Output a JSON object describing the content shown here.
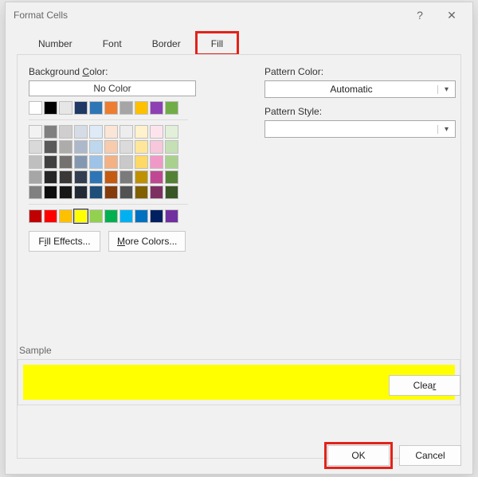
{
  "window": {
    "title": "Format Cells",
    "help": "?",
    "close": "✕"
  },
  "tabs": {
    "items": [
      "Number",
      "Font",
      "Border",
      "Fill"
    ],
    "active_index": 3,
    "highlight_index": 3
  },
  "fill": {
    "bg_label": "Background Color:",
    "nocolor_label": "No Color",
    "fill_effects": "Fill Effects...",
    "more_colors": "More Colors...",
    "theme_row0": [
      "#ffffff",
      "#000000",
      "#e7e6e6",
      "#1f3864",
      "#2e75b6",
      "#ed7d31",
      "#a5a5a5",
      "#ffc000",
      "#8e3fb4",
      "#70ad47"
    ],
    "theme_grid": [
      [
        "#f2f2f2",
        "#7f7f7f",
        "#d0cece",
        "#d6dce5",
        "#deebf7",
        "#fbe5d6",
        "#ededed",
        "#fff2cc",
        "#fde4ec",
        "#e2f0d9"
      ],
      [
        "#d9d9d9",
        "#595959",
        "#aeabab",
        "#adb9ca",
        "#bdd7ee",
        "#f8cbad",
        "#dbdbdb",
        "#ffe699",
        "#f7c7dc",
        "#c5e0b4"
      ],
      [
        "#bfbfbf",
        "#404040",
        "#757171",
        "#8497b0",
        "#9dc3e6",
        "#f4b183",
        "#c9c9c9",
        "#ffd966",
        "#f199c6",
        "#a9d18e"
      ],
      [
        "#a6a6a6",
        "#262626",
        "#3b3838",
        "#333f50",
        "#2e75b6",
        "#c55a11",
        "#7b7b7b",
        "#bf9000",
        "#c04893",
        "#548235"
      ],
      [
        "#808080",
        "#0d0d0d",
        "#171717",
        "#222a35",
        "#1f4e79",
        "#843c0c",
        "#525252",
        "#806000",
        "#7e2f62",
        "#385724"
      ]
    ],
    "standard_row": [
      "#c00000",
      "#ff0000",
      "#ffc000",
      "#ffff00",
      "#92d050",
      "#00b050",
      "#00b0f0",
      "#0070c0",
      "#002060",
      "#7030a0"
    ],
    "selected_color": "#ffff00"
  },
  "pattern": {
    "color_label": "Pattern Color:",
    "color_value": "Automatic",
    "style_label": "Pattern Style:",
    "style_value": ""
  },
  "sample": {
    "label": "Sample",
    "fill": "#ffff00"
  },
  "buttons": {
    "clear": "Clear",
    "ok": "OK",
    "cancel": "Cancel"
  }
}
